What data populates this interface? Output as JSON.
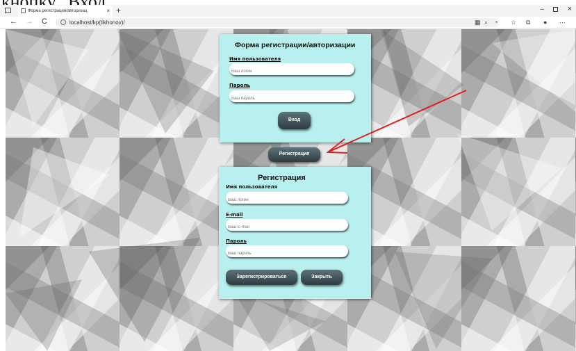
{
  "caption": "кнопку \"Вход\".",
  "browser": {
    "tab_title": "Форма регистрации/авторизац",
    "tab_close": "×",
    "new_tab": "+",
    "url": "localhost/kp(tikhonov)/",
    "back": "←",
    "forward": "→",
    "refresh": "C",
    "more": "···",
    "window_min": "–",
    "window_close": "×"
  },
  "login_form": {
    "title": "Форма регистрации/авторизации",
    "username_label": "Имя пользователя",
    "username_placeholder": "Ваш логин",
    "password_label": "Пароль",
    "password_placeholder": "Ваш пароль",
    "submit_label": "Вход"
  },
  "register_toggle_label": "Регистрация",
  "register_form": {
    "title": "Регистрация",
    "username_label": "Имя пользователя",
    "username_placeholder": "Ваш логин",
    "email_label": "E-mail",
    "email_placeholder": "Ваш E-mail",
    "password_label": "Пароль",
    "password_placeholder": "Ваш пароль",
    "register_button": "Зарегистрироваться",
    "close_button": "Закрыть"
  },
  "colors": {
    "panel_bg": "#b7f0ee",
    "button_bg": "#3b4b50",
    "arrow": "#e02020"
  }
}
